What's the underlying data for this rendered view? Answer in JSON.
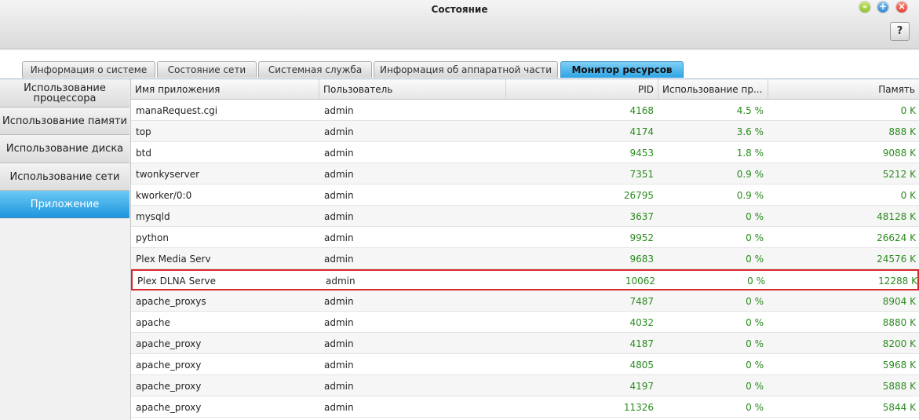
{
  "window": {
    "title": "Состояние",
    "help_label": "?"
  },
  "tabs": [
    {
      "label": "Информация о системе"
    },
    {
      "label": "Состояние сети"
    },
    {
      "label": "Системная служба"
    },
    {
      "label": "Информация об аппаратной части"
    },
    {
      "label": "Монитор ресурсов",
      "active": true
    }
  ],
  "sidebar": {
    "items": [
      {
        "label": "Использование процессора"
      },
      {
        "label": "Использование памяти"
      },
      {
        "label": "Использование диска"
      },
      {
        "label": "Использование сети"
      },
      {
        "label": "Приложение",
        "active": true
      }
    ]
  },
  "table": {
    "columns": [
      "Имя приложения",
      "Пользователь",
      "PID",
      "Использование пр...",
      "Память"
    ],
    "rows": [
      {
        "name": "manaRequest.cgi",
        "user": "admin",
        "pid": "4168",
        "cpu": "4.5 %",
        "mem": "0 K"
      },
      {
        "name": "top",
        "user": "admin",
        "pid": "4174",
        "cpu": "3.6 %",
        "mem": "888 K"
      },
      {
        "name": "btd",
        "user": "admin",
        "pid": "9453",
        "cpu": "1.8 %",
        "mem": "9088 K"
      },
      {
        "name": "twonkyserver",
        "user": "admin",
        "pid": "7351",
        "cpu": "0.9 %",
        "mem": "5212 K"
      },
      {
        "name": "kworker/0:0",
        "user": "admin",
        "pid": "26795",
        "cpu": "0.9 %",
        "mem": "0 K"
      },
      {
        "name": "mysqld",
        "user": "admin",
        "pid": "3637",
        "cpu": "0 %",
        "mem": "48128 K"
      },
      {
        "name": "python",
        "user": "admin",
        "pid": "9952",
        "cpu": "0 %",
        "mem": "26624 K"
      },
      {
        "name": "Plex Media Serv",
        "user": "admin",
        "pid": "9683",
        "cpu": "0 %",
        "mem": "24576 K"
      },
      {
        "name": "Plex DLNA Serve",
        "user": "admin",
        "pid": "10062",
        "cpu": "0 %",
        "mem": "12288 K",
        "selected": true
      },
      {
        "name": "apache_proxys",
        "user": "admin",
        "pid": "7487",
        "cpu": "0 %",
        "mem": "8904 K"
      },
      {
        "name": "apache",
        "user": "admin",
        "pid": "4032",
        "cpu": "0 %",
        "mem": "8880 K"
      },
      {
        "name": "apache_proxy",
        "user": "admin",
        "pid": "4187",
        "cpu": "0 %",
        "mem": "8200 K"
      },
      {
        "name": "apache_proxy",
        "user": "admin",
        "pid": "4805",
        "cpu": "0 %",
        "mem": "5968 K"
      },
      {
        "name": "apache_proxy",
        "user": "admin",
        "pid": "4197",
        "cpu": "0 %",
        "mem": "5888 K"
      },
      {
        "name": "apache_proxy",
        "user": "admin",
        "pid": "11326",
        "cpu": "0 %",
        "mem": "5844 K"
      }
    ]
  },
  "colors": {
    "accent": "#2ea3e3",
    "value_green": "#2a8a1e",
    "selection_border": "#d9262c"
  }
}
